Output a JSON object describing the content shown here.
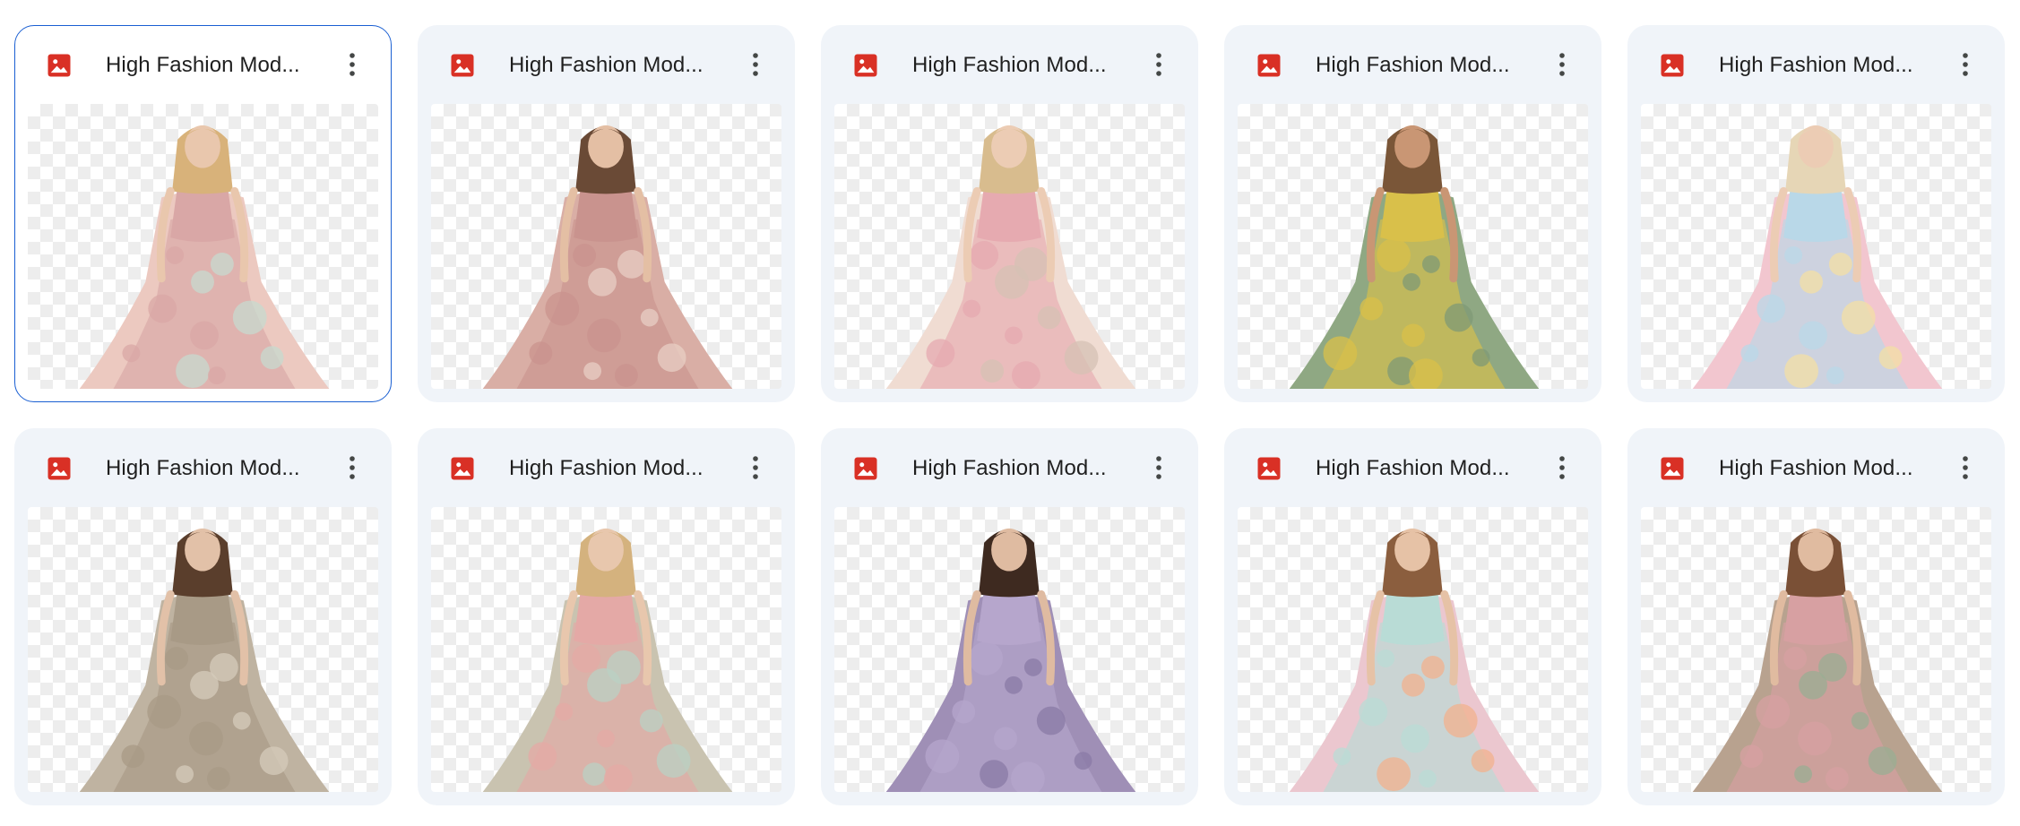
{
  "files": [
    {
      "title": "High Fashion Mod...",
      "icon": "image-file-icon",
      "selected": true,
      "palette": {
        "dress": "#ecc9c0",
        "accent": "#d9a7a6",
        "trim": "#c7d9cf",
        "hair": "#d8b27a",
        "skin": "#e9c7ad"
      }
    },
    {
      "title": "High Fashion Mod...",
      "icon": "image-file-icon",
      "selected": false,
      "palette": {
        "dress": "#d9aea5",
        "accent": "#c9938e",
        "trim": "#e8cfc4",
        "hair": "#6a4a36",
        "skin": "#e4bfa4"
      }
    },
    {
      "title": "High Fashion Mod...",
      "icon": "image-file-icon",
      "selected": false,
      "palette": {
        "dress": "#f0dcd2",
        "accent": "#e6aab0",
        "trim": "#d6c2b4",
        "hair": "#d8bc8e",
        "skin": "#ecccb4"
      }
    },
    {
      "title": "High Fashion Mod...",
      "icon": "image-file-icon",
      "selected": false,
      "palette": {
        "dress": "#8fa883",
        "accent": "#d9c04a",
        "trim": "#7f9a75",
        "hair": "#7a5638",
        "skin": "#c99674"
      }
    },
    {
      "title": "High Fashion Mod...",
      "icon": "image-file-icon",
      "selected": false,
      "palette": {
        "dress": "#f2c6cf",
        "accent": "#b9d8e8",
        "trim": "#f3dfa4",
        "hair": "#e6d6b6",
        "skin": "#ecccb4"
      }
    },
    {
      "title": "High Fashion Mod...",
      "icon": "image-file-icon",
      "selected": false,
      "palette": {
        "dress": "#bfb3a1",
        "accent": "#a89a86",
        "trim": "#d6cbbb",
        "hair": "#5a3e2c",
        "skin": "#e2c1a8"
      }
    },
    {
      "title": "High Fashion Mod...",
      "icon": "image-file-icon",
      "selected": false,
      "palette": {
        "dress": "#c9c3b0",
        "accent": "#e4a9a6",
        "trim": "#b9d0c4",
        "hair": "#d4b27e",
        "skin": "#e8c7ad"
      }
    },
    {
      "title": "High Fashion Mod...",
      "icon": "image-file-icon",
      "selected": false,
      "palette": {
        "dress": "#9f8fb6",
        "accent": "#b6a6cc",
        "trim": "#8a7aa6",
        "hair": "#3e2a20",
        "skin": "#dfbba1"
      }
    },
    {
      "title": "High Fashion Mod...",
      "icon": "image-file-icon",
      "selected": false,
      "palette": {
        "dress": "#ebc7cf",
        "accent": "#b9dcd6",
        "trim": "#f2b28e",
        "hair": "#8b5e3e",
        "skin": "#e6c2a6"
      }
    },
    {
      "title": "High Fashion Mod...",
      "icon": "image-file-icon",
      "selected": false,
      "palette": {
        "dress": "#b8a28f",
        "accent": "#d7a0a2",
        "trim": "#9aae93",
        "hair": "#7a5036",
        "skin": "#e0bba0"
      }
    }
  ],
  "icons": {
    "file": "image-file-icon",
    "more": "more-vert-icon"
  },
  "colors": {
    "card_bg": "#f0f4f9",
    "selected_border": "#1a5fd2",
    "image_icon": "#d93025",
    "title_text": "#1f1f1f"
  }
}
